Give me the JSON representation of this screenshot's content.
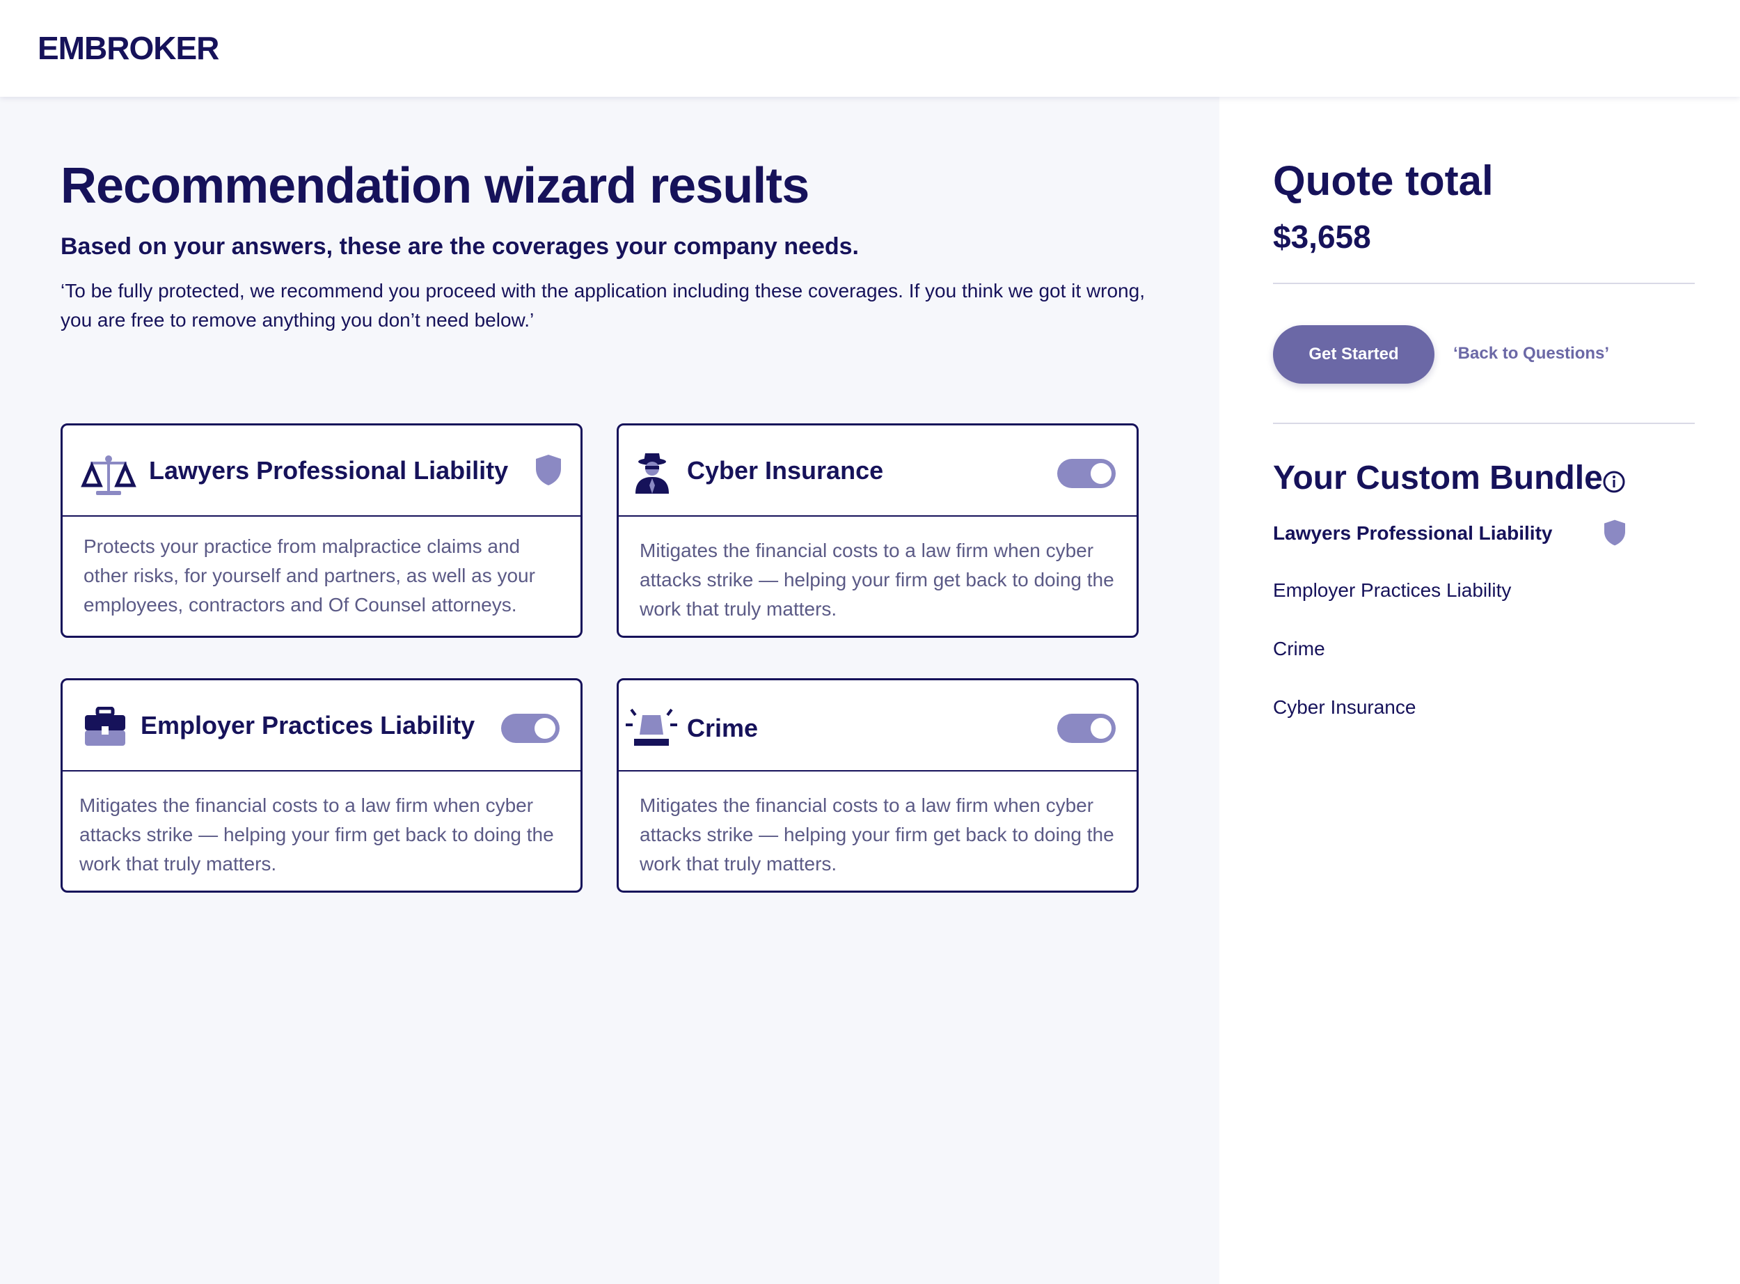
{
  "header": {
    "logo": "EMBROKER"
  },
  "main": {
    "title": "Recommendation wizard results",
    "subtitle": "Based on your answers, these are the coverages your company needs.",
    "intro": "‘To be fully protected, we recommend you proceed with the application including these coverages. If you think we got it wrong, you are free to remove anything you don’t need  below.’",
    "cards": [
      {
        "title": "Lawyers Professional Liability",
        "icon": "scales-icon",
        "control": "shield-icon",
        "description": "Protects your practice from malpractice claims and other risks, for yourself and partners, as well as your employees, contractors and Of Counsel attorneys."
      },
      {
        "title": "Cyber Insurance",
        "icon": "hacker-icon",
        "control": "toggle",
        "toggle_on": true,
        "description": "Mitigates the financial costs to a law firm when cyber attacks strike — helping your firm get back to doing the work that truly matters."
      },
      {
        "title": "Employer Practices Liability",
        "icon": "briefcase-icon",
        "control": "toggle",
        "toggle_on": true,
        "description": "Mitigates the financial costs to a law firm when cyber attacks strike — helping your firm get back to doing the work that truly matters."
      },
      {
        "title": "Crime",
        "icon": "siren-icon",
        "control": "toggle",
        "toggle_on": true,
        "description": "Mitigates the financial costs to a law firm when cyber attacks strike — helping your firm get back to doing the work that truly matters."
      }
    ]
  },
  "sidebar": {
    "quote_title": "Quote total",
    "quote_amount": "$3,658",
    "primary_button": "Get Started",
    "secondary_link": "‘Back to Questions’",
    "bundle_title": "Your Custom Bundle",
    "bundle_items": [
      "Lawyers Professional Liability",
      "Employer Practices Liability",
      "Crime",
      "Cyber Insurance"
    ]
  },
  "colors": {
    "navy": "#16125a",
    "accent": "#6b68a6",
    "toggle": "#8b89c3",
    "muted_text": "#5b5a86",
    "main_bg": "#f6f7fb"
  }
}
